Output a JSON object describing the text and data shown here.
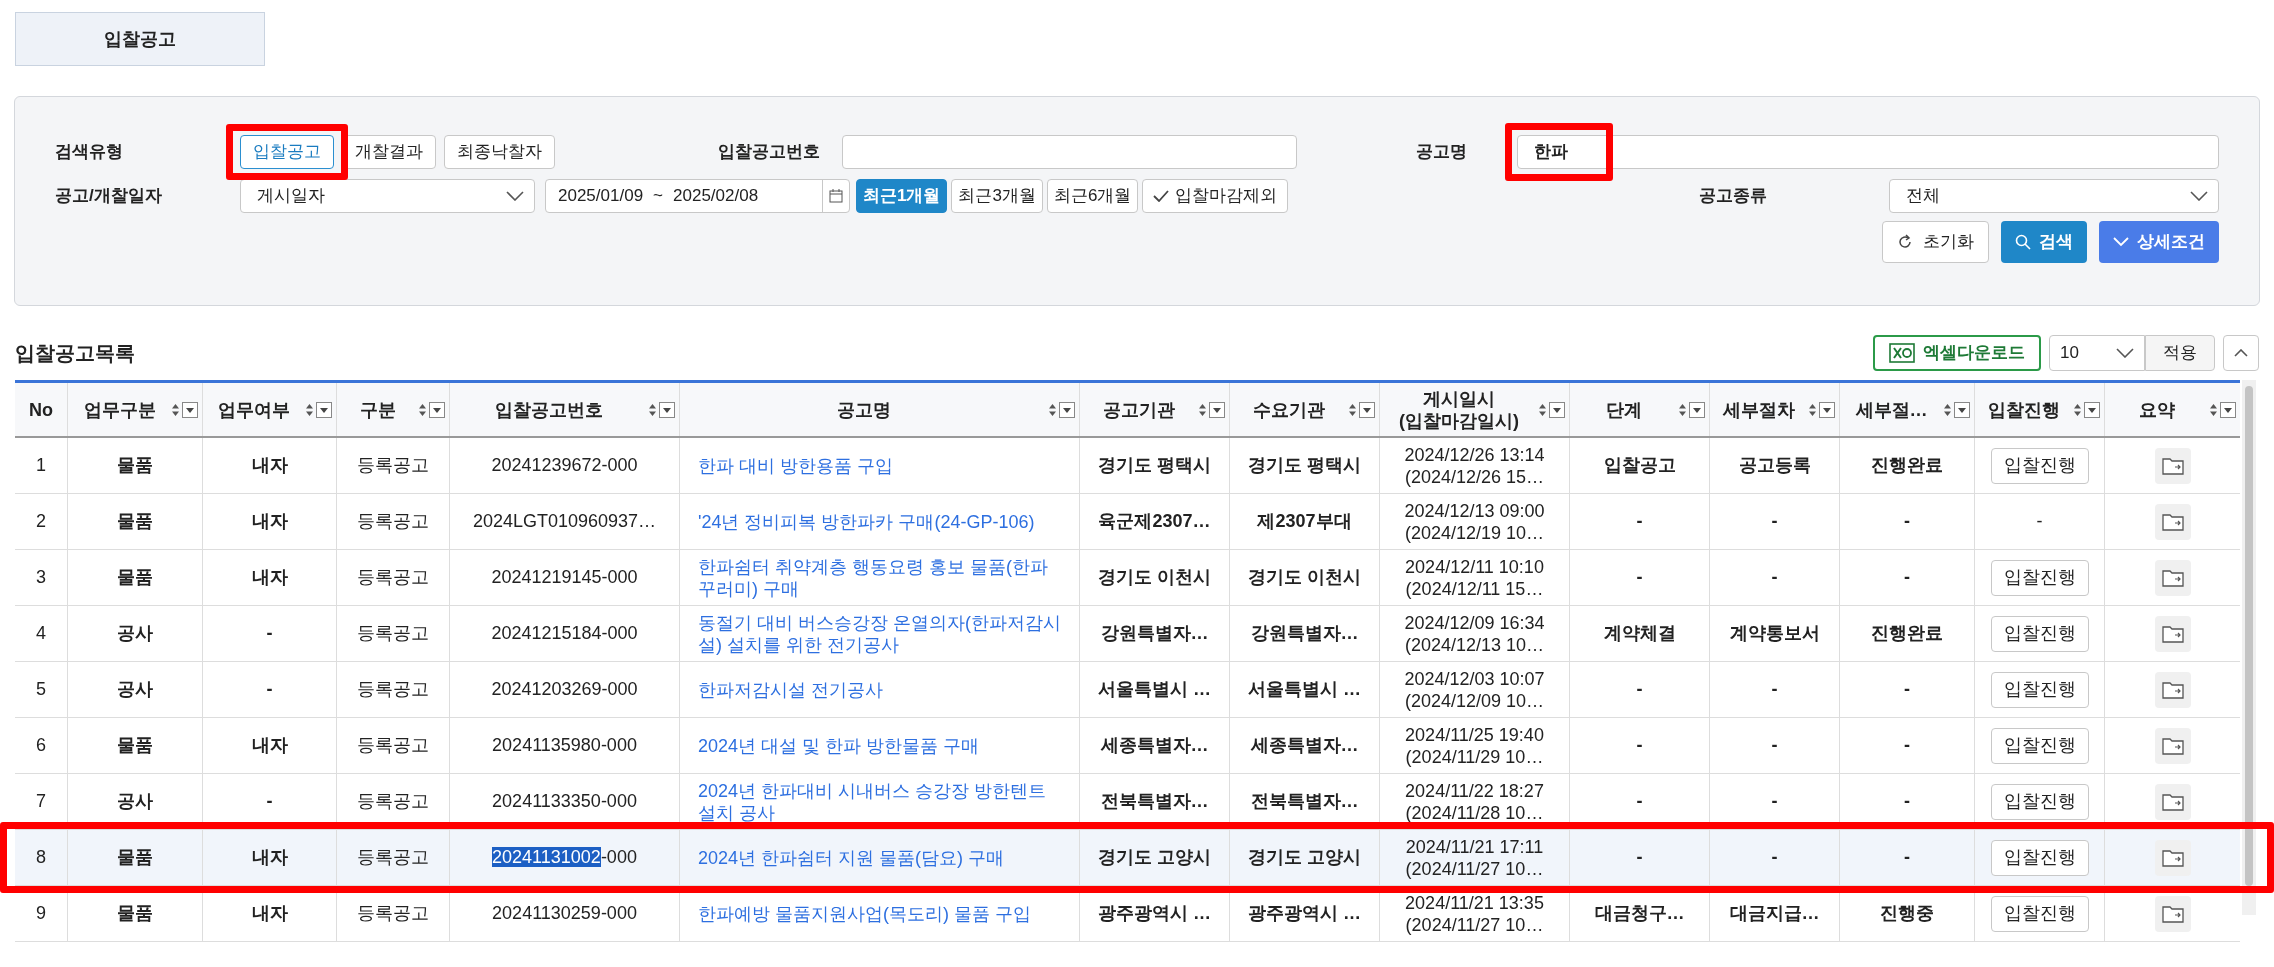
{
  "page_tab": {
    "label": "입찰공고",
    "selected": true
  },
  "search": {
    "type_label": "검색유형",
    "types": [
      {
        "label": "입찰공고",
        "selected": true,
        "highlighted": true
      },
      {
        "label": "개찰결과",
        "selected": false,
        "highlighted": false
      },
      {
        "label": "최종낙찰자",
        "selected": false,
        "highlighted": false
      }
    ],
    "bid_no_label": "입찰공고번호",
    "title_label": "공고명",
    "title_value": "한파",
    "title_highlighted": true,
    "date_label": "공고/개찰일자",
    "date_type": "게시일자",
    "date_from": "2025/01/09",
    "date_sep": "~",
    "date_to": "2025/02/08",
    "periods": [
      {
        "label": "최근1개월",
        "selected": true
      },
      {
        "label": "최근3개월",
        "selected": false
      },
      {
        "label": "최근6개월",
        "selected": false
      }
    ],
    "exclude_closed": {
      "label": "입찰마감제외",
      "checked": true
    },
    "kind_label": "공고종류",
    "kind_value": "전체",
    "reset": "초기화",
    "search": "검색",
    "detail": "상세조건"
  },
  "list": {
    "title": "입찰공고목록",
    "excel": "엑셀다운로드",
    "page_size": "10",
    "apply": "적용",
    "columns": [
      {
        "label": "No",
        "sortable": false
      },
      {
        "label": "업무구분",
        "sortable": true
      },
      {
        "label": "업무여부",
        "sortable": true
      },
      {
        "label": "구분",
        "sortable": true
      },
      {
        "label": "입찰공고번호",
        "sortable": true
      },
      {
        "label": "공고명",
        "sortable": true
      },
      {
        "label": "공고기관",
        "sortable": true
      },
      {
        "label": "수요기관",
        "sortable": true
      },
      {
        "label": "게시일시\n(입찰마감일시)",
        "sortable": true
      },
      {
        "label": "단계",
        "sortable": true
      },
      {
        "label": "세부절차",
        "sortable": true
      },
      {
        "label": "세부절…",
        "sortable": true
      },
      {
        "label": "입찰진행",
        "sortable": true
      },
      {
        "label": "요약",
        "sortable": true
      }
    ],
    "rows": [
      {
        "no": "1",
        "work": "물품",
        "domestic": "내자",
        "category": "등록공고",
        "bid_no": [
          {
            "text": "20241239672-000",
            "selected": false
          }
        ],
        "title": "한파 대비 방한용품 구입",
        "agency": "경기도 평택시",
        "demand": "경기도 평택시",
        "posted": "2024/12/26 13:14",
        "deadline": "(2024/12/26 15…",
        "stage": "입찰공고",
        "step": "공고등록",
        "status": "진행완료",
        "progress": {
          "kind": "button",
          "label": "입찰진행"
        },
        "highlighted": false
      },
      {
        "no": "2",
        "work": "물품",
        "domestic": "내자",
        "category": "등록공고",
        "bid_no": [
          {
            "text": "2024LGT010960937…",
            "selected": false
          }
        ],
        "title": "'24년 정비피복 방한파카 구매(24-GP-106)",
        "agency": "육군제2307…",
        "demand": "제2307부대",
        "posted": "2024/12/13 09:00",
        "deadline": "(2024/12/19 10…",
        "stage": "-",
        "step": "-",
        "status": "-",
        "progress": {
          "kind": "text",
          "label": "-"
        },
        "highlighted": false
      },
      {
        "no": "3",
        "work": "물품",
        "domestic": "내자",
        "category": "등록공고",
        "bid_no": [
          {
            "text": "20241219145-000",
            "selected": false
          }
        ],
        "title": "한파쉼터 취약계층 행동요령 홍보 물품(한파꾸러미) 구매",
        "agency": "경기도 이천시",
        "demand": "경기도 이천시",
        "posted": "2024/12/11 10:10",
        "deadline": "(2024/12/11 15…",
        "stage": "-",
        "step": "-",
        "status": "-",
        "progress": {
          "kind": "button",
          "label": "입찰진행"
        },
        "highlighted": false
      },
      {
        "no": "4",
        "work": "공사",
        "domestic": "-",
        "category": "등록공고",
        "bid_no": [
          {
            "text": "20241215184-000",
            "selected": false
          }
        ],
        "title": "동절기 대비 버스승강장 온열의자(한파저감시설) 설치를 위한 전기공사",
        "agency": "강원특별자…",
        "demand": "강원특별자…",
        "posted": "2024/12/09 16:34",
        "deadline": "(2024/12/13 10…",
        "stage": "계약체결",
        "step": "계약통보서",
        "status": "진행완료",
        "progress": {
          "kind": "button",
          "label": "입찰진행"
        },
        "highlighted": false
      },
      {
        "no": "5",
        "work": "공사",
        "domestic": "-",
        "category": "등록공고",
        "bid_no": [
          {
            "text": "20241203269-000",
            "selected": false
          }
        ],
        "title": "한파저감시설 전기공사",
        "agency": "서울특별시 …",
        "demand": "서울특별시 …",
        "posted": "2024/12/03 10:07",
        "deadline": "(2024/12/09 10…",
        "stage": "-",
        "step": "-",
        "status": "-",
        "progress": {
          "kind": "button",
          "label": "입찰진행"
        },
        "highlighted": false
      },
      {
        "no": "6",
        "work": "물품",
        "domestic": "내자",
        "category": "등록공고",
        "bid_no": [
          {
            "text": "20241135980-000",
            "selected": false
          }
        ],
        "title": "2024년 대설 및 한파 방한물품 구매",
        "agency": "세종특별자…",
        "demand": "세종특별자…",
        "posted": "2024/11/25 19:40",
        "deadline": "(2024/11/29 10…",
        "stage": "-",
        "step": "-",
        "status": "-",
        "progress": {
          "kind": "button",
          "label": "입찰진행"
        },
        "highlighted": false
      },
      {
        "no": "7",
        "work": "공사",
        "domestic": "-",
        "category": "등록공고",
        "bid_no": [
          {
            "text": "20241133350-000",
            "selected": false
          }
        ],
        "title": "2024년 한파대비 시내버스 승강장 방한텐트 설치 공사",
        "agency": "전북특별자…",
        "demand": "전북특별자…",
        "posted": "2024/11/22 18:27",
        "deadline": "(2024/11/28 10…",
        "stage": "-",
        "step": "-",
        "status": "-",
        "progress": {
          "kind": "button",
          "label": "입찰진행"
        },
        "highlighted": false
      },
      {
        "no": "8",
        "work": "물품",
        "domestic": "내자",
        "category": "등록공고",
        "bid_no": [
          {
            "text": "20241131002",
            "selected": true
          },
          {
            "text": "-000",
            "selected": false
          }
        ],
        "title": "2024년 한파쉼터 지원 물품(담요) 구매",
        "agency": "경기도 고양시",
        "demand": "경기도 고양시",
        "posted": "2024/11/21 17:11",
        "deadline": "(2024/11/27 10…",
        "stage": "-",
        "step": "-",
        "status": "-",
        "progress": {
          "kind": "button",
          "label": "입찰진행"
        },
        "highlighted": true
      },
      {
        "no": "9",
        "work": "물품",
        "domestic": "내자",
        "category": "등록공고",
        "bid_no": [
          {
            "text": "20241130259-000",
            "selected": false
          }
        ],
        "title": "한파예방 물품지원사업(목도리) 물품 구입",
        "agency": "광주광역시 …",
        "demand": "광주광역시 …",
        "posted": "2024/11/21 13:35",
        "deadline": "(2024/11/27 10…",
        "stage": "대금청구…",
        "step": "대금지급…",
        "status": "진행중",
        "progress": {
          "kind": "button",
          "label": "입찰진행"
        },
        "highlighted": false
      }
    ]
  }
}
